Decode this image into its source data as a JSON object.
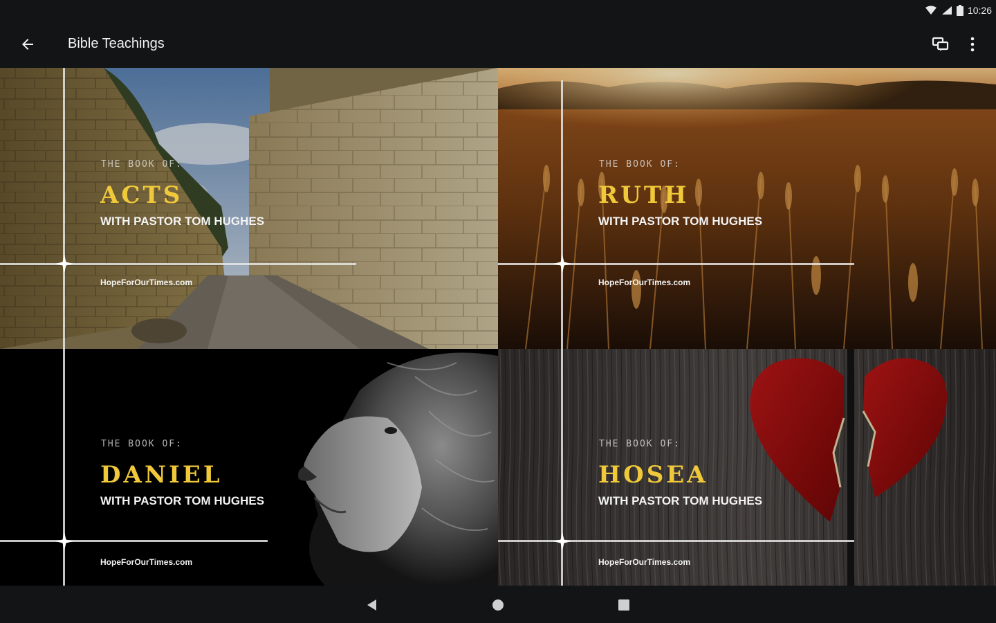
{
  "status_bar": {
    "time": "10:26",
    "icons": [
      "wifi-icon",
      "signal-icon",
      "battery-icon"
    ]
  },
  "app_bar": {
    "title": "Bible Teachings",
    "back_icon": "arrow-back-icon",
    "cast_icon": "cast-icon",
    "more_icon": "more-vert-icon"
  },
  "cards": [
    {
      "book_of": "THE BOOK OF:",
      "title": "ACTS",
      "subtitle": "WITH PASTOR TOM HUGHES",
      "site": "HopeForOurTimes.com",
      "image": "stone-wall-alley"
    },
    {
      "book_of": "THE BOOK OF:",
      "title": "RUTH",
      "subtitle": "WITH PASTOR TOM HUGHES",
      "site": "HopeForOurTimes.com",
      "image": "wheat-field-sunset"
    },
    {
      "book_of": "THE BOOK OF:",
      "title": "DANIEL",
      "subtitle": "WITH PASTOR TOM HUGHES",
      "site": "HopeForOurTimes.com",
      "image": "lion-profile"
    },
    {
      "book_of": "THE BOOK OF:",
      "title": "HOSEA",
      "subtitle": "WITH PASTOR TOM HUGHES",
      "site": "HopeForOurTimes.com",
      "image": "broken-heart-wood"
    }
  ],
  "nav_bar": {
    "icons": [
      "nav-back-icon",
      "nav-home-icon",
      "nav-recents-icon"
    ]
  },
  "colors": {
    "title_gold": "#f0c93a",
    "bar_bg": "#131416",
    "text_light": "#f2f2f2"
  }
}
